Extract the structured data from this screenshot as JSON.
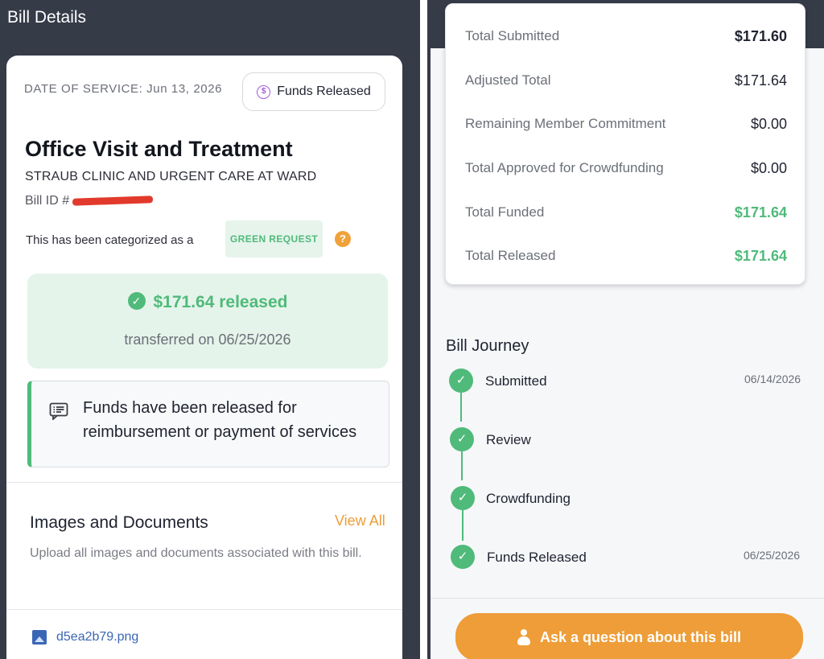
{
  "left_panel": {
    "title": "Bill Details",
    "date_of_service": "DATE OF SERVICE: Jun 13, 2026",
    "status_pill": {
      "icon": "dollar-circle-icon",
      "label": "Funds Released"
    },
    "visit_title": "Office Visit and Treatment",
    "clinic": "STRAUB CLINIC AND URGENT CARE AT WARD",
    "bill_id_label": "Bill ID #",
    "category_text": "This has been categorized as a",
    "category_chip": "GREEN REQUEST",
    "help_icon": "?",
    "release": {
      "amount": "$171.64 released",
      "date": "transferred on 06/25/2026"
    },
    "notice": {
      "icon": "message-icon",
      "text": "Funds have been released for reimbursement or payment of services"
    },
    "documents": {
      "title": "Images and Documents",
      "view_all": "View All",
      "subtitle": "Upload all images and documents associated with this bill.",
      "files": [
        {
          "icon": "image-file-icon",
          "name": "d5ea2b79.png"
        }
      ]
    }
  },
  "right_panel": {
    "summary": [
      {
        "label": "Total Submitted",
        "value": "$171.60",
        "style": "bold"
      },
      {
        "label": "Adjusted Total",
        "value": "$171.64",
        "style": "normal"
      },
      {
        "label": "Remaining Member Commitment",
        "value": "$0.00",
        "style": "normal"
      },
      {
        "label": "Total Approved for Crowdfunding",
        "value": "$0.00",
        "style": "normal"
      },
      {
        "label": "Total Funded",
        "value": "$171.64",
        "style": "green"
      },
      {
        "label": "Total Released",
        "value": "$171.64",
        "style": "green"
      }
    ],
    "journey": {
      "title": "Bill Journey",
      "steps": [
        {
          "label": "Submitted",
          "date": "06/14/2026",
          "status": "complete"
        },
        {
          "label": "Review",
          "date": "",
          "status": "complete"
        },
        {
          "label": "Crowdfunding",
          "date": "",
          "status": "complete"
        },
        {
          "label": "Funds Released",
          "date": "06/25/2026",
          "status": "complete"
        }
      ]
    },
    "ask_button": {
      "icon": "person-icon",
      "label": "Ask a question about this bill"
    }
  },
  "colors": {
    "accent_green": "#4fba7a",
    "accent_orange": "#ee9d38",
    "background_dark": "#363b48",
    "pill_icon": "#a259d9"
  }
}
